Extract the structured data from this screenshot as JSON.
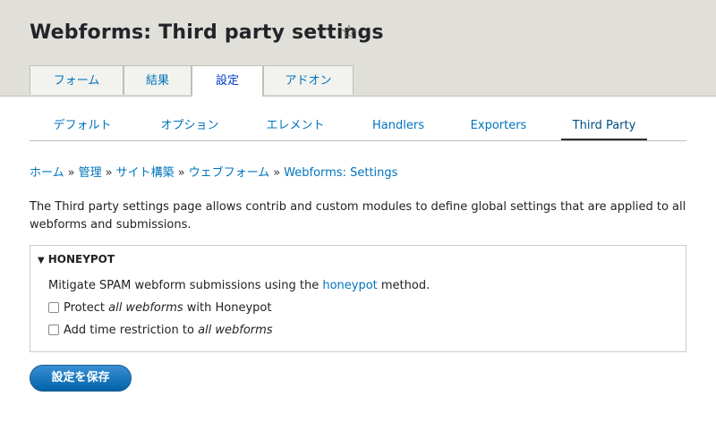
{
  "header": {
    "title": "Webforms: Third party settings",
    "star_glyph": "☆"
  },
  "primary_tabs": [
    {
      "label": "フォーム",
      "active": false
    },
    {
      "label": "結果",
      "active": false
    },
    {
      "label": "設定",
      "active": true
    },
    {
      "label": "アドオン",
      "active": false
    }
  ],
  "secondary_tabs": [
    {
      "label": "デフォルト",
      "active": false
    },
    {
      "label": "オプション",
      "active": false
    },
    {
      "label": "エレメント",
      "active": false
    },
    {
      "label": "Handlers",
      "active": false
    },
    {
      "label": "Exporters",
      "active": false
    },
    {
      "label": "Third Party",
      "active": true
    }
  ],
  "breadcrumb": {
    "items": [
      "ホーム",
      "管理",
      "サイト構築",
      "ウェブフォーム",
      "Webforms: Settings"
    ],
    "separator": "»"
  },
  "description": "The Third party settings page allows contrib and custom modules to define global settings that are applied to all webforms and submissions.",
  "honeypot": {
    "summary": "HONEYPOT",
    "triangle_glyph": "▼",
    "text_before": "Mitigate SPAM webform submissions using the ",
    "link": "honeypot",
    "text_after": " method.",
    "checkbox1": {
      "before": "Protect ",
      "em": "all webforms",
      "after": " with Honeypot",
      "checked": false
    },
    "checkbox2": {
      "before": "Add time restriction to ",
      "em": "all webforms",
      "after": "",
      "checked": false
    }
  },
  "save_button": "設定を保存",
  "colors": {
    "link": "#0074bd",
    "header_bg": "#e0dfd9",
    "button": "#0071b8"
  }
}
